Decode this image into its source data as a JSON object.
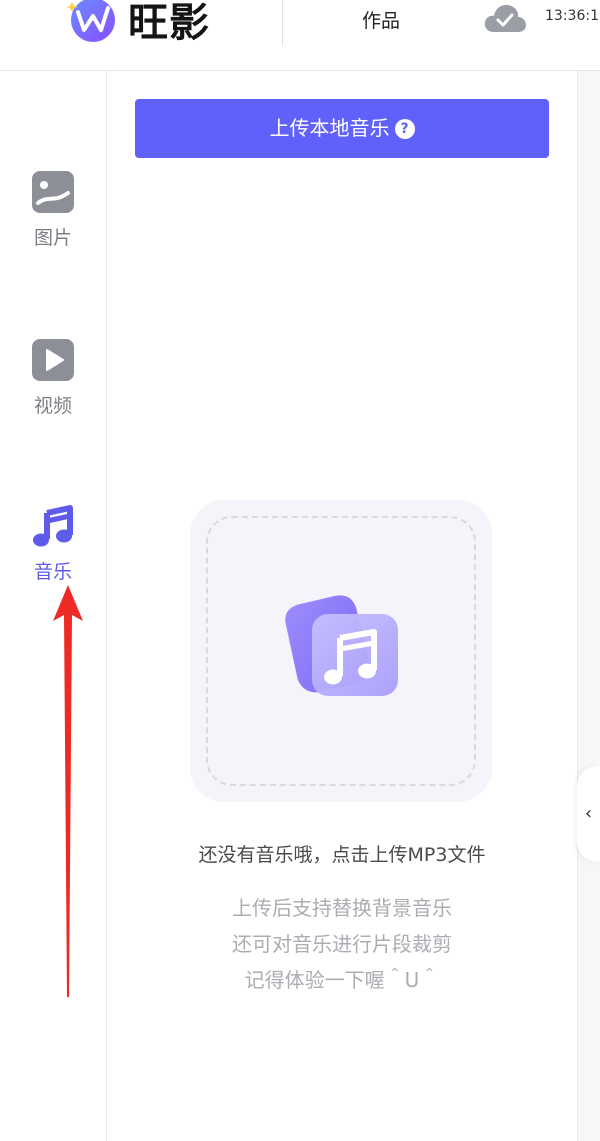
{
  "header": {
    "brand": "旺影",
    "nav_works": "作品",
    "time": "13:36:1"
  },
  "sidebar": {
    "items": [
      {
        "label": "图片",
        "icon": "image-icon",
        "active": false
      },
      {
        "label": "视频",
        "icon": "video-play-icon",
        "active": false
      },
      {
        "label": "音乐",
        "icon": "music-note-icon",
        "active": true
      }
    ]
  },
  "main": {
    "upload_label": "上传本地音乐",
    "help_glyph": "?",
    "empty_title": "还没有音乐哦，点击上传MP3文件",
    "empty_lines": [
      "上传后支持替换背景音乐",
      "还可对音乐进行片段裁剪",
      "记得体验一下喔＾U＾"
    ]
  },
  "colors": {
    "accent": "#6060fb",
    "inactive": "#7d7f86",
    "annotation_arrow": "#ee2a24"
  }
}
